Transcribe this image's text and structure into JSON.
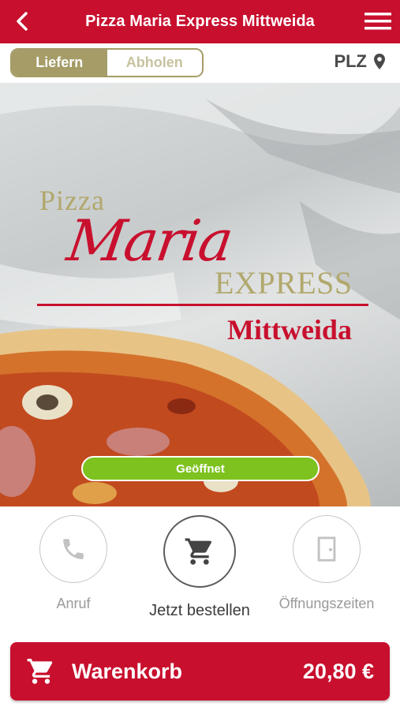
{
  "header": {
    "title": "Pizza Maria Express Mittweida",
    "back_icon": "chevron-left-icon",
    "menu_icon": "hamburger-menu-icon",
    "color": "#c8102e"
  },
  "delivery": {
    "options": [
      "Liefern",
      "Abholen"
    ],
    "selected": "Liefern",
    "plz_label": "PLZ",
    "plz_icon": "location-pin-icon",
    "accent": "#a59c67"
  },
  "hero": {
    "logo_line1": "Pizza",
    "logo_line2": "Maria",
    "logo_line3": "EXPRESS",
    "logo_line4": "Mittweida",
    "status": "Geöffnet",
    "status_color": "#7dc21f"
  },
  "actions": [
    {
      "label": "Anruf",
      "icon": "phone-icon"
    },
    {
      "label": "Jetzt bestellen",
      "icon": "cart-icon"
    },
    {
      "label": "Öffnungszeiten",
      "icon": "door-icon"
    }
  ],
  "cart": {
    "label": "Warenkorb",
    "total": "20,80 €",
    "icon": "cart-icon"
  }
}
